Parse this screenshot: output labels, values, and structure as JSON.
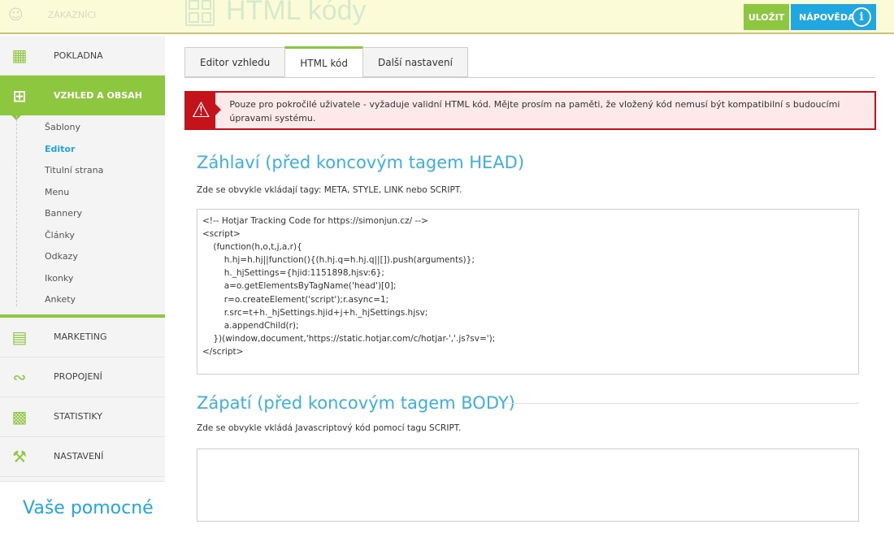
{
  "topbar": {
    "customers_label": "ZÁKAZNÍCI",
    "page_title": "HTML kódy",
    "save_label": "ULOŽIT",
    "help_label": "NÁPOVĚDA"
  },
  "sidebar": {
    "items": [
      {
        "label": "POKLADNA",
        "icon": "cash-register-icon"
      },
      {
        "label": "VZHLED A OBSAH",
        "icon": "layout-grid-icon"
      },
      {
        "label": "MARKETING",
        "icon": "money-icon"
      },
      {
        "label": "PROPOJENÍ",
        "icon": "connection-icon"
      },
      {
        "label": "STATISTIKY",
        "icon": "chart-icon"
      },
      {
        "label": "NASTAVENÍ",
        "icon": "wrench-icon"
      }
    ],
    "subitems": [
      "Šablony",
      "Editor",
      "Titulní strana",
      "Menu",
      "Bannery",
      "Články",
      "Odkazy",
      "Ikonky",
      "Ankety"
    ],
    "help_box": "Vaše pomocné"
  },
  "tabs": [
    "Editor vzhledu",
    "HTML kód",
    "Další nastavení"
  ],
  "alert": "Pouze pro pokročilé uživatele - vyžaduje validní HTML kód. Mějte prosím na paměti, že vložený kód nemusí být kompatibilní s budoucími úpravami systému.",
  "head": {
    "title": "Záhlaví (před koncovým tagem HEAD)",
    "desc": "Zde se obvykle vkládají tagy: META, STYLE, LINK nebo SCRIPT.",
    "code": "<!-- Hotjar Tracking Code for https://simonjun.cz/ -->\n<script>\n    (function(h,o,t,j,a,r){\n        h.hj=h.hj||function(){(h.hj.q=h.hj.q||[]).push(arguments)};\n        h._hjSettings={hjid:1151898,hjsv:6};\n        a=o.getElementsByTagName('head')[0];\n        r=o.createElement('script');r.async=1;\n        r.src=t+h._hjSettings.hjid+j+h._hjSettings.hjsv;\n        a.appendChild(r);\n    })(window,document,'https://static.hotjar.com/c/hotjar-','.js?sv=');\n</script>"
  },
  "body": {
    "title": "Zápatí (před koncovým tagem BODY)",
    "desc": "Zde se obvykle vkládá Javascriptový kód pomocí tagu SCRIPT.",
    "code": ""
  }
}
